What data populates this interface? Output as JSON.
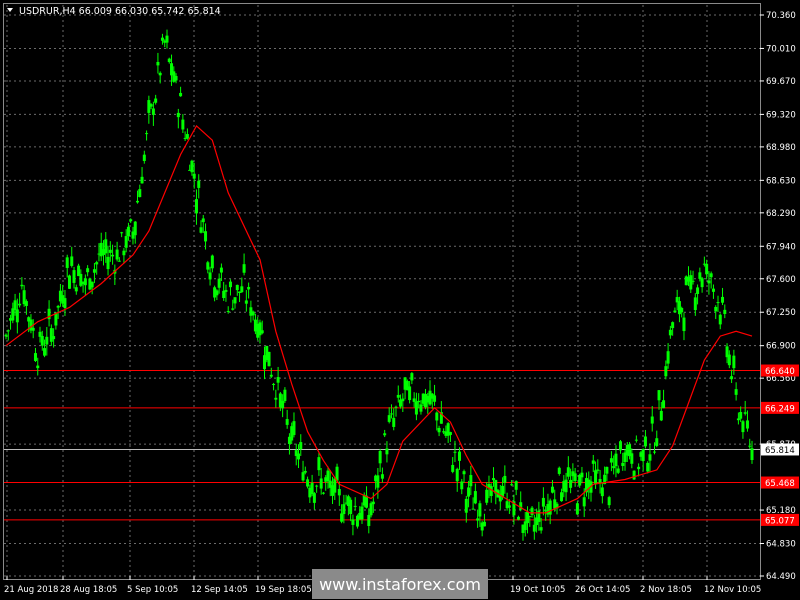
{
  "header": {
    "symbol_line": "USDRUR,H4  66.009 66.030 65.742 65.814",
    "menu_icon": "triangle-down-icon"
  },
  "watermark": {
    "text": "www.instaforex.com"
  },
  "colors": {
    "background": "#000000",
    "grid": "#6b6b6b",
    "candle": "#00ff00",
    "moving_average": "#ff0000",
    "level_line": "#ff0000",
    "current_price_label": "#ffffff",
    "watermark_bg": "#8a8a8a"
  },
  "chart_data": {
    "type": "line",
    "title": "USDRUR,H4",
    "ohlc_header": {
      "open": 66.009,
      "high": 66.03,
      "low": 65.742,
      "close": 65.814
    },
    "ylim": [
      64.49,
      70.36
    ],
    "y_ticks": [
      "70.360",
      "70.010",
      "69.670",
      "69.320",
      "68.980",
      "68.630",
      "68.290",
      "67.940",
      "67.600",
      "67.250",
      "66.900",
      "66.560",
      "65.870",
      "65.180",
      "64.830",
      "64.490"
    ],
    "x_ticks": [
      "21 Aug 2018",
      "28 Aug 18:05",
      "5 Sep 10:05",
      "12 Sep 14:05",
      "19 Sep 18:05",
      "19 Oct 10:05",
      "26 Oct 14:05",
      "2 Nov 18:05",
      "12 Nov 10:05"
    ],
    "grid": true,
    "price_series": [
      {
        "x": "21 Aug 2018",
        "y": 67.0
      },
      {
        "x": "23 Aug",
        "y": 67.55
      },
      {
        "x": "24 Aug",
        "y": 66.85
      },
      {
        "x": "27 Aug",
        "y": 67.1
      },
      {
        "x": "28 Aug 18:05",
        "y": 67.75
      },
      {
        "x": "30 Aug",
        "y": 67.55
      },
      {
        "x": "31 Aug",
        "y": 67.85
      },
      {
        "x": "3 Sep",
        "y": 67.85
      },
      {
        "x": "4 Sep",
        "y": 68.1
      },
      {
        "x": "5 Sep 10:05",
        "y": 69.2
      },
      {
        "x": "6 Sep",
        "y": 70.05
      },
      {
        "x": "7 Sep",
        "y": 69.4
      },
      {
        "x": "10 Sep",
        "y": 68.55
      },
      {
        "x": "11 Sep",
        "y": 67.7
      },
      {
        "x": "12 Sep 14:05",
        "y": 67.4
      },
      {
        "x": "13 Sep",
        "y": 67.5
      },
      {
        "x": "14 Sep",
        "y": 67.1
      },
      {
        "x": "17 Sep",
        "y": 66.5
      },
      {
        "x": "18 Sep",
        "y": 65.9
      },
      {
        "x": "19 Sep 18:05",
        "y": 65.55
      },
      {
        "x": "21 Sep",
        "y": 65.45
      },
      {
        "x": "24 Sep",
        "y": 65.3
      },
      {
        "x": "25 Sep",
        "y": 65.2
      },
      {
        "x": "26 Sep",
        "y": 65.15
      },
      {
        "x": "27 Sep",
        "y": 65.95
      },
      {
        "x": "1 Oct",
        "y": 66.35
      },
      {
        "x": "3 Oct",
        "y": 66.4
      },
      {
        "x": "4 Oct",
        "y": 66.25
      },
      {
        "x": "8 Oct",
        "y": 65.85
      },
      {
        "x": "10 Oct",
        "y": 65.35
      },
      {
        "x": "12 Oct",
        "y": 65.2
      },
      {
        "x": "15 Oct",
        "y": 65.4
      },
      {
        "x": "17 Oct",
        "y": 65.3
      },
      {
        "x": "19 Oct 10:05",
        "y": 64.95
      },
      {
        "x": "22 Oct",
        "y": 65.2
      },
      {
        "x": "24 Oct",
        "y": 65.5
      },
      {
        "x": "26 Oct 14:05",
        "y": 65.4
      },
      {
        "x": "29 Oct",
        "y": 65.5
      },
      {
        "x": "31 Oct",
        "y": 65.45
      },
      {
        "x": "2 Nov 18:05",
        "y": 65.85
      },
      {
        "x": "6 Nov",
        "y": 65.7
      },
      {
        "x": "7 Nov",
        "y": 66.0
      },
      {
        "x": "8 Nov",
        "y": 67.15
      },
      {
        "x": "9 Nov",
        "y": 67.45
      },
      {
        "x": "12 Nov 10:05",
        "y": 67.7
      },
      {
        "x": "13 Nov",
        "y": 67.35
      },
      {
        "x": "14 Nov",
        "y": 66.35
      },
      {
        "x": "15 Nov",
        "y": 65.81
      }
    ],
    "moving_average": [
      {
        "x": "21 Aug 2018",
        "y": 66.9
      },
      {
        "x": "24 Aug",
        "y": 67.15
      },
      {
        "x": "28 Aug 18:05",
        "y": 67.3
      },
      {
        "x": "31 Aug",
        "y": 67.55
      },
      {
        "x": "4 Sep",
        "y": 67.85
      },
      {
        "x": "5 Sep 10:05",
        "y": 68.1
      },
      {
        "x": "7 Sep",
        "y": 68.9
      },
      {
        "x": "10 Sep",
        "y": 69.2
      },
      {
        "x": "11 Sep",
        "y": 69.05
      },
      {
        "x": "12 Sep 14:05",
        "y": 68.5
      },
      {
        "x": "14 Sep",
        "y": 67.8
      },
      {
        "x": "17 Sep",
        "y": 67.05
      },
      {
        "x": "18 Sep",
        "y": 66.5
      },
      {
        "x": "19 Sep 18:05",
        "y": 66.0
      },
      {
        "x": "21 Sep",
        "y": 65.7
      },
      {
        "x": "24 Sep",
        "y": 65.45
      },
      {
        "x": "26 Sep",
        "y": 65.3
      },
      {
        "x": "27 Sep",
        "y": 65.45
      },
      {
        "x": "1 Oct",
        "y": 65.9
      },
      {
        "x": "4 Oct",
        "y": 66.25
      },
      {
        "x": "8 Oct",
        "y": 66.1
      },
      {
        "x": "10 Oct",
        "y": 65.75
      },
      {
        "x": "12 Oct",
        "y": 65.45
      },
      {
        "x": "17 Oct",
        "y": 65.25
      },
      {
        "x": "19 Oct 10:05",
        "y": 65.15
      },
      {
        "x": "22 Oct",
        "y": 65.15
      },
      {
        "x": "26 Oct 14:05",
        "y": 65.3
      },
      {
        "x": "29 Oct",
        "y": 65.45
      },
      {
        "x": "2 Nov 18:05",
        "y": 65.5
      },
      {
        "x": "7 Nov",
        "y": 65.6
      },
      {
        "x": "8 Nov",
        "y": 65.85
      },
      {
        "x": "9 Nov",
        "y": 66.3
      },
      {
        "x": "12 Nov 10:05",
        "y": 66.75
      },
      {
        "x": "13 Nov",
        "y": 67.0
      },
      {
        "x": "14 Nov",
        "y": 67.05
      },
      {
        "x": "15 Nov",
        "y": 67.0
      }
    ],
    "horizontal_levels": [
      {
        "label": "66.640",
        "value": 66.64
      },
      {
        "label": "66.249",
        "value": 66.249
      },
      {
        "label": "65.468",
        "value": 65.468
      },
      {
        "label": "65.077",
        "value": 65.077
      }
    ],
    "current_price": {
      "label": "65.814",
      "value": 65.814
    }
  }
}
